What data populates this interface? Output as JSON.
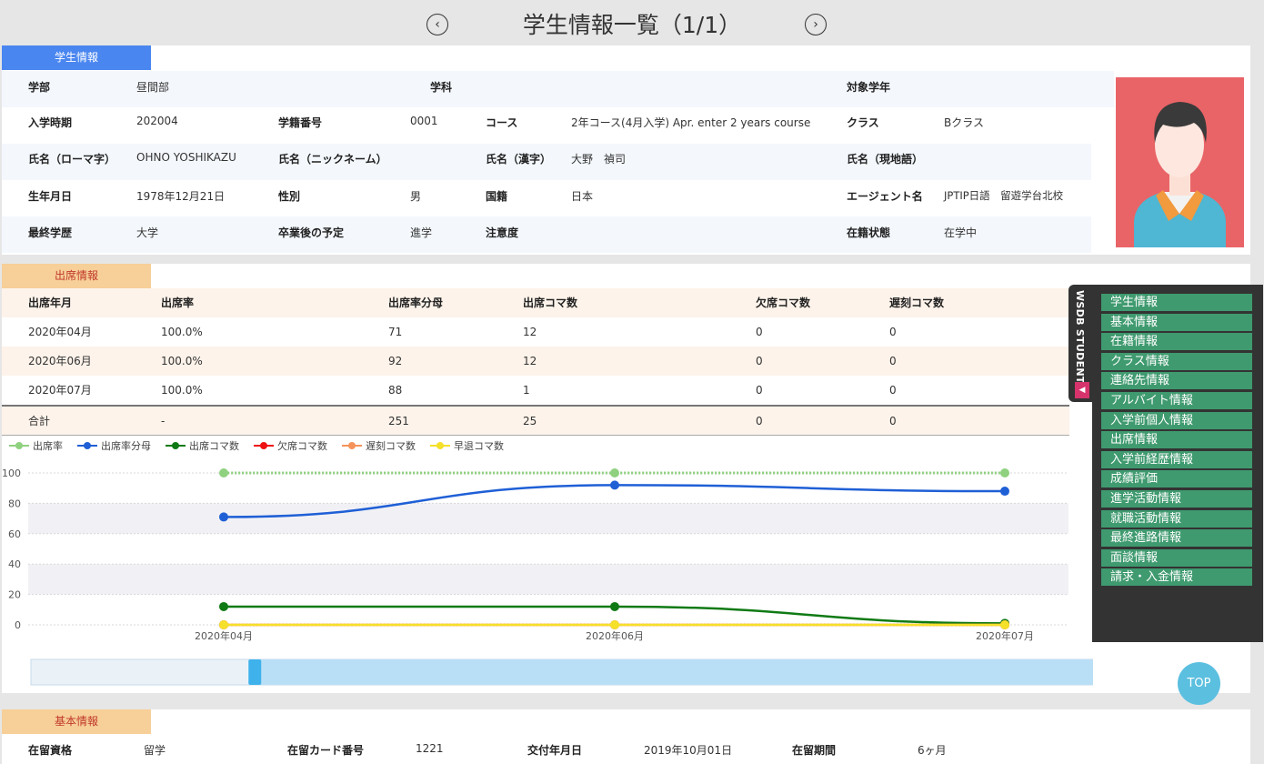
{
  "page": {
    "title": "学生情報一覧（1/1）",
    "prev_icon": "chevron-left-icon",
    "next_icon": "chevron-right-icon"
  },
  "student": {
    "section_label": "学生情報",
    "faculty_label": "学部",
    "faculty": "昼間部",
    "department_label": "学科",
    "department": "",
    "target_grade_label": "対象学年",
    "target_grade": "",
    "enroll_period_label": "入学時期",
    "enroll_period": "202004",
    "student_no_label": "学籍番号",
    "student_no": "0001",
    "course_label": "コース",
    "course": "2年コース(4月入学) Apr. enter 2 years course",
    "class_label": "クラス",
    "class": "Bクラス",
    "name_roman_label": "氏名（ローマ字）",
    "name_roman": "OHNO YOSHIKAZU",
    "nickname_label": "氏名（ニックネーム）",
    "nickname": "",
    "name_kanji_label": "氏名（漢字）",
    "name_kanji": "大野　禎司",
    "name_local_label": "氏名（現地語）",
    "name_local": "",
    "birthdate_label": "生年月日",
    "birthdate": "1978年12月21日",
    "gender_label": "性別",
    "gender": "男",
    "nationality_label": "国籍",
    "nationality": "日本",
    "agent_label": "エージェント名",
    "agent": "JPTIP日語　留遊学台北校",
    "education_label": "最終学歴",
    "education": "大学",
    "plan_label": "卒業後の予定",
    "plan": "進学",
    "caution_label": "注意度",
    "caution": "",
    "status_label": "在籍状態",
    "status": "在学中",
    "avatar_bg": "#e96467"
  },
  "attendance": {
    "section_label": "出席情報",
    "headers": [
      "出席年月",
      "出席率",
      "出席率分母",
      "出席コマ数",
      "欠席コマ数",
      "遅刻コマ数"
    ],
    "rows": [
      [
        "2020年04月",
        "100.0%",
        "71",
        "12",
        "0",
        "0"
      ],
      [
        "2020年06月",
        "100.0%",
        "92",
        "12",
        "0",
        "0"
      ],
      [
        "2020年07月",
        "100.0%",
        "88",
        "1",
        "0",
        "0"
      ]
    ],
    "total": [
      "合計",
      "-",
      "251",
      "25",
      "0",
      "0"
    ]
  },
  "chart_data": {
    "type": "line",
    "categories": [
      "2020年04月",
      "2020年06月",
      "2020年07月"
    ],
    "ylim": [
      0,
      100
    ],
    "yticks": [
      "0",
      "20",
      "40",
      "60",
      "80",
      "100"
    ],
    "grid": true,
    "legend_position": "top-left",
    "series": [
      {
        "name": "出席率",
        "values": [
          100,
          100,
          100
        ],
        "color": "#8fd17f"
      },
      {
        "name": "出席率分母",
        "values": [
          71,
          92,
          88
        ],
        "color": "#1f5fd6"
      },
      {
        "name": "出席コマ数",
        "values": [
          12,
          12,
          1
        ],
        "color": "#0f7a14"
      },
      {
        "name": "欠席コマ数",
        "values": [
          0,
          0,
          0
        ],
        "color": "#ee1111"
      },
      {
        "name": "遅刻コマ数",
        "values": [
          0,
          0,
          0
        ],
        "color": "#f6935a"
      },
      {
        "name": "早退コマ数",
        "values": [
          0,
          0,
          0
        ],
        "color": "#f5e02a"
      }
    ],
    "zoom_range": [
      0.19,
      1.0
    ]
  },
  "sidebar": {
    "tab_label": "WSDB STUDENT",
    "collapse_icon": "caret-left-icon",
    "items": [
      "学生情報",
      "基本情報",
      "在籍情報",
      "クラス情報",
      "連絡先情報",
      "アルバイト情報",
      "入学前個人情報",
      "出席情報",
      "入学前経歴情報",
      "成績評価",
      "進学活動情報",
      "就職活動情報",
      "最終進路情報",
      "面談情報",
      "請求・入金情報"
    ]
  },
  "top_button": "TOP",
  "basic": {
    "section_label": "基本情報",
    "visa_label": "在留資格",
    "visa": "留学",
    "card_label": "在留カード番号",
    "card": "1221",
    "issue_label": "交付年月日",
    "issue": "2019年10月01日",
    "period_label": "在留期間",
    "period": "6ヶ月"
  },
  "colors": {
    "accent_blue": "#4a86f0",
    "section_orange": "#f7cf98",
    "menu_green": "#3f9a6f"
  }
}
